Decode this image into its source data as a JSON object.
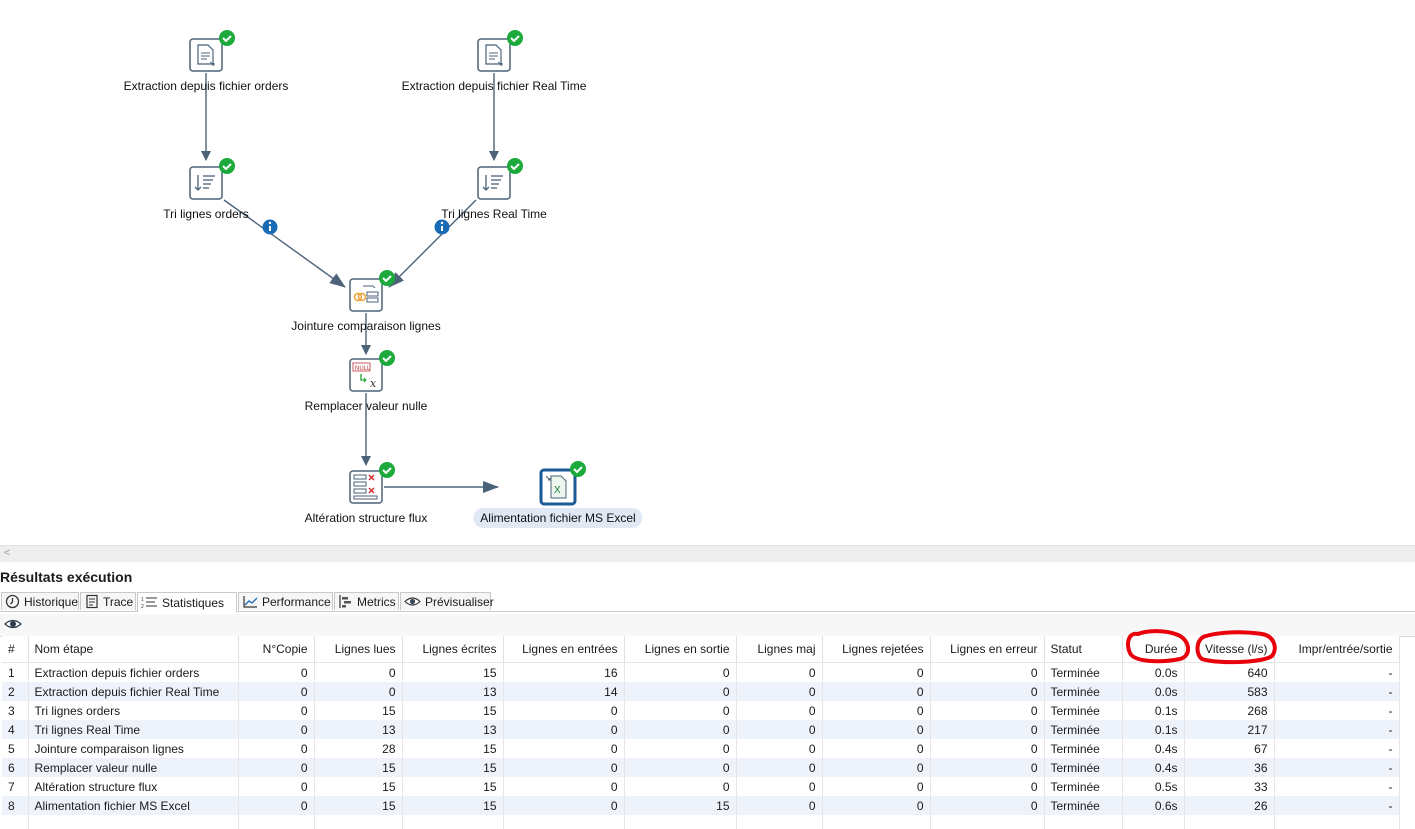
{
  "canvas": {
    "nodes": [
      {
        "id": "n1",
        "label": "Extraction depuis fichier orders",
        "icon": "text-file-input-icon",
        "status": "success"
      },
      {
        "id": "n2",
        "label": "Extraction depuis fichier Real Time",
        "icon": "text-file-input-icon",
        "status": "success"
      },
      {
        "id": "n3",
        "label": "Tri lignes orders",
        "icon": "sort-rows-icon",
        "status": "success"
      },
      {
        "id": "n4",
        "label": "Tri lignes Real Time",
        "icon": "sort-rows-icon",
        "status": "success"
      },
      {
        "id": "n5",
        "label": "Jointure comparaison lignes",
        "icon": "merge-rows-icon",
        "status": "success"
      },
      {
        "id": "n6",
        "label": "Remplacer valeur nulle",
        "icon": "replace-null-icon",
        "status": "success"
      },
      {
        "id": "n7",
        "label": "Altération structure flux",
        "icon": "select-values-icon",
        "status": "success"
      },
      {
        "id": "n8",
        "label": "Alimentation fichier MS Excel",
        "icon": "excel-output-icon",
        "status": "success"
      }
    ],
    "hop_info_icon": "info-icon",
    "selected_node": "n8"
  },
  "results": {
    "title": "Résultats exécution",
    "tabs": [
      {
        "label": "Historique",
        "icon": "history-clock-icon"
      },
      {
        "label": "Trace",
        "icon": "log-document-icon"
      },
      {
        "label": "Statistiques",
        "icon": "step-metrics-icon",
        "active": true
      },
      {
        "label": "Performance",
        "icon": "performance-chart-icon"
      },
      {
        "label": "Metrics",
        "icon": "metrics-gantt-icon"
      },
      {
        "label": "Prévisualiser",
        "icon": "preview-eye-icon"
      }
    ],
    "toolbar_icon": "preview-eye-icon",
    "columns": [
      "#",
      "Nom étape",
      "N°Copie",
      "Lignes lues",
      "Lignes écrites",
      "Lignes en entrées",
      "Lignes en sortie",
      "Lignes maj",
      "Lignes rejetées",
      "Lignes en erreur",
      "Statut",
      "Durée",
      "Vitesse (l/s)",
      "Impr/entrée/sortie"
    ],
    "rows": [
      [
        "1",
        "Extraction depuis fichier orders",
        "0",
        "0",
        "15",
        "16",
        "0",
        "0",
        "0",
        "0",
        "Terminée",
        "0.0s",
        "640",
        "-"
      ],
      [
        "2",
        "Extraction depuis fichier Real Time",
        "0",
        "0",
        "13",
        "14",
        "0",
        "0",
        "0",
        "0",
        "Terminée",
        "0.0s",
        "583",
        "-"
      ],
      [
        "3",
        "Tri lignes orders",
        "0",
        "15",
        "15",
        "0",
        "0",
        "0",
        "0",
        "0",
        "Terminée",
        "0.1s",
        "268",
        "-"
      ],
      [
        "4",
        "Tri lignes Real Time",
        "0",
        "13",
        "13",
        "0",
        "0",
        "0",
        "0",
        "0",
        "Terminée",
        "0.1s",
        "217",
        "-"
      ],
      [
        "5",
        "Jointure comparaison lignes",
        "0",
        "28",
        "15",
        "0",
        "0",
        "0",
        "0",
        "0",
        "Terminée",
        "0.4s",
        "67",
        "-"
      ],
      [
        "6",
        "Remplacer valeur nulle",
        "0",
        "15",
        "15",
        "0",
        "0",
        "0",
        "0",
        "0",
        "Terminée",
        "0.4s",
        "36",
        "-"
      ],
      [
        "7",
        "Altération structure flux",
        "0",
        "15",
        "15",
        "0",
        "0",
        "0",
        "0",
        "0",
        "Terminée",
        "0.5s",
        "33",
        "-"
      ],
      [
        "8",
        "Alimentation fichier MS Excel",
        "0",
        "15",
        "15",
        "0",
        "15",
        "0",
        "0",
        "0",
        "Terminée",
        "0.6s",
        "26",
        "-"
      ]
    ]
  },
  "colors": {
    "accent": "#1a6bb5",
    "success": "#1bab3a",
    "hop": "#4b6278",
    "annotation_red": "#e8000b"
  }
}
